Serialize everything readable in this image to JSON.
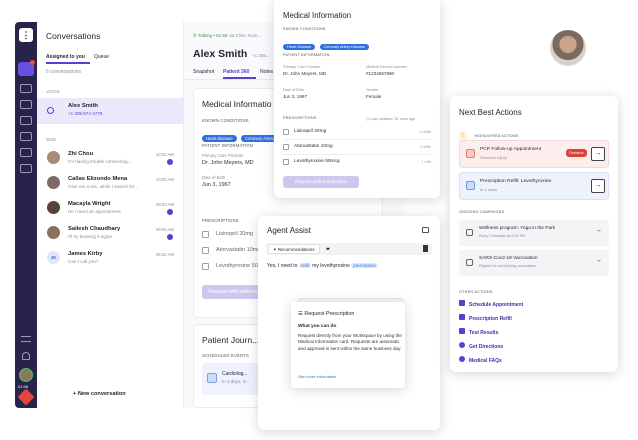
{
  "nav": {
    "status_time": "01:58"
  },
  "conversations": {
    "title": "Conversations",
    "tabs": [
      "Assigned to you",
      "Queue"
    ],
    "count": "6 conversations",
    "voice_header": "VOICE",
    "sms_header": "SMS",
    "voice_item": {
      "name": "Alex Smith",
      "phone": "+1 305-574-4775"
    },
    "sms_items": [
      {
        "name": "Zhi Chou",
        "msg": "I'm having trouble connecting...",
        "time": "10:02 AM",
        "unread": true
      },
      {
        "name": "Callas Elizondo Mena",
        "msg": "Give me a sec, while I search for...",
        "time": "10:00 AM",
        "unread": false
      },
      {
        "name": "Macayla Wright",
        "msg": "Hi! I need an appointment",
        "time": "09:53 AM",
        "unread": true
      },
      {
        "name": "Sailesh Chaudhary",
        "msg": "I'll try booking it again",
        "time": "09:50 AM",
        "unread": true
      },
      {
        "name": "James Kirby",
        "initials": "JK",
        "msg": "Can I call you?",
        "time": "09:32 AM",
        "unread": false
      }
    ],
    "new_conversation": "New conversation"
  },
  "main": {
    "call_status": "Talking • 01:58",
    "call_via": "via Clinic Num...",
    "patient_name": "Alex Smith",
    "patient_phone": "+1 305...",
    "tabs": [
      "Snapshot",
      "Patient 360",
      "Notes"
    ],
    "medical_title": "Medical Informatio",
    "known_conditions": "KNOWN CONDITIONS",
    "conditions": [
      "Heart Disease",
      "Coronary Artery Disease"
    ],
    "patient_info": "PATIENT INFORMATION",
    "pcp_label": "Primary Care Provider",
    "pcp": "Dr. John Meyers, MD",
    "dob_label": "Date of Birth",
    "dob": "Jun 3, 1967",
    "prescriptions": "PRESCRIPTIONS",
    "rx": [
      "Lisinopril 20mg",
      "Atorvastatin 10mg",
      "Levothyroxine 50mcg"
    ],
    "refill_btn": "Request refill authorization",
    "journey_title": "Patient Journ...",
    "scheduled_events": "SCHEDULED EVENTS",
    "event_title": "Cardiolog...",
    "event_sub": "In 3 days, D..."
  },
  "medinfo": {
    "title": "Medical Information",
    "known_conditions": "KNOWN CONDITIONS",
    "conditions": [
      "Heart Disease",
      "Coronary Artery Disease"
    ],
    "patient_info": "PATIENT INFORMATION",
    "pcp_label": "Primary Care Provider",
    "pcp": "Dr. John Meyers, MD",
    "mrn_label": "Medical Record Number",
    "mrn": "#1234567890",
    "dob_label": "Date of Birth",
    "dob": "Jun 3, 1967",
    "gender_label": "Gender",
    "gender": "Female",
    "prescriptions": "PRESCRIPTIONS",
    "last_updated": "Last updated: 30 mins ago",
    "rx": [
      {
        "name": "Lisinopril 20mg",
        "note": "4 refills"
      },
      {
        "name": "Atorvastatin 10mg",
        "note": "3 refills"
      },
      {
        "name": "Levothyroxine 50mcg",
        "note": "1 refill"
      }
    ],
    "refill_btn": "Request refill authorization"
  },
  "assist": {
    "title": "Agent Assist",
    "tab": "Recommendations",
    "message_parts": [
      "Yes, I need to",
      "refill",
      "my levothyroxine",
      "prescription"
    ],
    "popover_title": "Request Prescription",
    "popover_sub": "What you can do",
    "popover_body": "Request directly from your Workspace by using the Medical Information card. Requests are automatic and approval is sent within the same business day.",
    "popover_link": "See more information"
  },
  "nba": {
    "title": "Next Best Actions",
    "highlighted": "HIGHLIGHTED ACTIONS",
    "actions": [
      {
        "title": "PCP Follow-up Appointment",
        "sub": "Shoulder Injury",
        "badge": "Overdue"
      },
      {
        "title": "Prescription Refill: Levothyroxine",
        "sub": "In 1 week",
        "badge": ""
      }
    ],
    "ongoing": "ONGOING CAMPAIGNS",
    "campaigns": [
      {
        "title": "Wellness program: Yoga in the Park",
        "sub": "Every Tuesdays at 5:00 PM"
      },
      {
        "title": "SARS-Cov2-19 Vaccination",
        "sub": "Eligible for scheduling vaccination"
      }
    ],
    "other": "OTHER ACTIONS",
    "other_actions": [
      "Schedule Appointment",
      "Prescription Refill",
      "Test Results",
      "Get Directions",
      "Medical FAQs"
    ]
  }
}
